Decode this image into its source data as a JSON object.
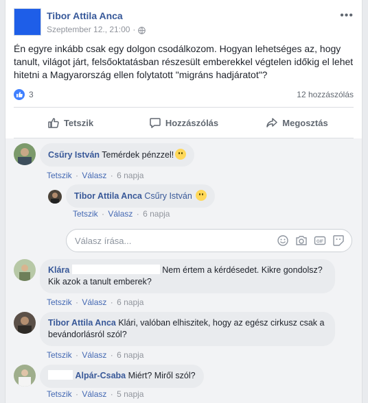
{
  "post": {
    "author": "Tibor Attila Anca",
    "date": "Szeptember 12., 21:00",
    "separator": "·",
    "more": "•••",
    "text": "Én egyre inkább csak egy dolgon csodálkozom. Hogyan lehetséges az, hogy tanult, világot járt, felsőoktatásban részesült emberekkel végtelen időkig el lehet hitetni a Magyarország ellen folytatott \"migráns hadjáratot\"?",
    "like_count": "3",
    "comment_count": "12 hozzászólás"
  },
  "actions": {
    "like": "Tetszik",
    "comment": "Hozzászólás",
    "share": "Megosztás"
  },
  "comments": [
    {
      "author": "Csűry István",
      "text": "Temérdek pénzzel!",
      "like": "Tetszik",
      "reply": "Válasz",
      "time": "6 napja"
    },
    {
      "author": "Tibor Attila Anca",
      "mention": "Csűry István",
      "text": "",
      "like": "Tetszik",
      "reply": "Válasz",
      "time": "6 napja"
    },
    {
      "author": "Klára",
      "text": "Nem értem a kérdésedet. Kikre gondolsz? Kik azok a tanult emberek?",
      "like": "Tetszik",
      "reply": "Válasz",
      "time": "6 napja"
    },
    {
      "author": "Tibor Attila Anca",
      "text": "Klári, valóban elhiszitek, hogy az egész cirkusz csak a bevándorlásról szól?",
      "like": "Tetszik",
      "reply": "Válasz",
      "time": "6 napja"
    },
    {
      "author": "Alpár-Csaba",
      "text": "Miért? Miről szól?",
      "like": "Tetszik",
      "reply": "Válasz",
      "time": "5 napja"
    }
  ],
  "reply_box": {
    "placeholder": "Válasz írása..."
  },
  "colors": {
    "link": "#385898",
    "like_blue": "#4080ff",
    "bubble": "#e9ebee"
  }
}
